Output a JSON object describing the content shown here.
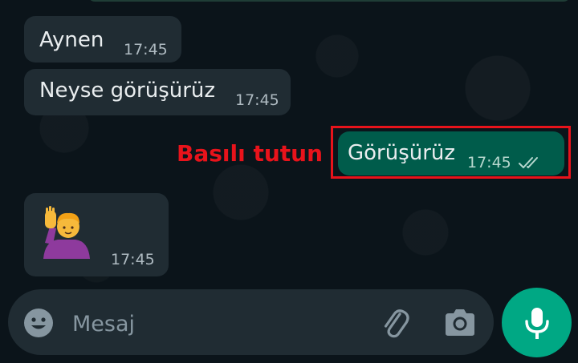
{
  "messages": [
    {
      "direction": "incoming",
      "text": "Aynen",
      "time": "17:45"
    },
    {
      "direction": "incoming",
      "text": "Neyse görüşürüz",
      "time": "17:45"
    },
    {
      "direction": "outgoing",
      "text": "Görüşürüz",
      "time": "17:45",
      "status": "read"
    },
    {
      "direction": "incoming",
      "emoji": "person-raising-hand",
      "time": "17:45"
    }
  ],
  "annotation": {
    "text": "Basılı tutun",
    "color": "#e8131b"
  },
  "composer": {
    "placeholder": "Mesaj",
    "icons": [
      "emoji-icon",
      "paperclip-icon",
      "camera-icon",
      "microphone-icon"
    ]
  },
  "colors": {
    "background": "#0b141a",
    "incoming_bubble": "#202c33",
    "outgoing_bubble": "#005c4b",
    "accent": "#00a884",
    "highlight": "#e8131b"
  }
}
